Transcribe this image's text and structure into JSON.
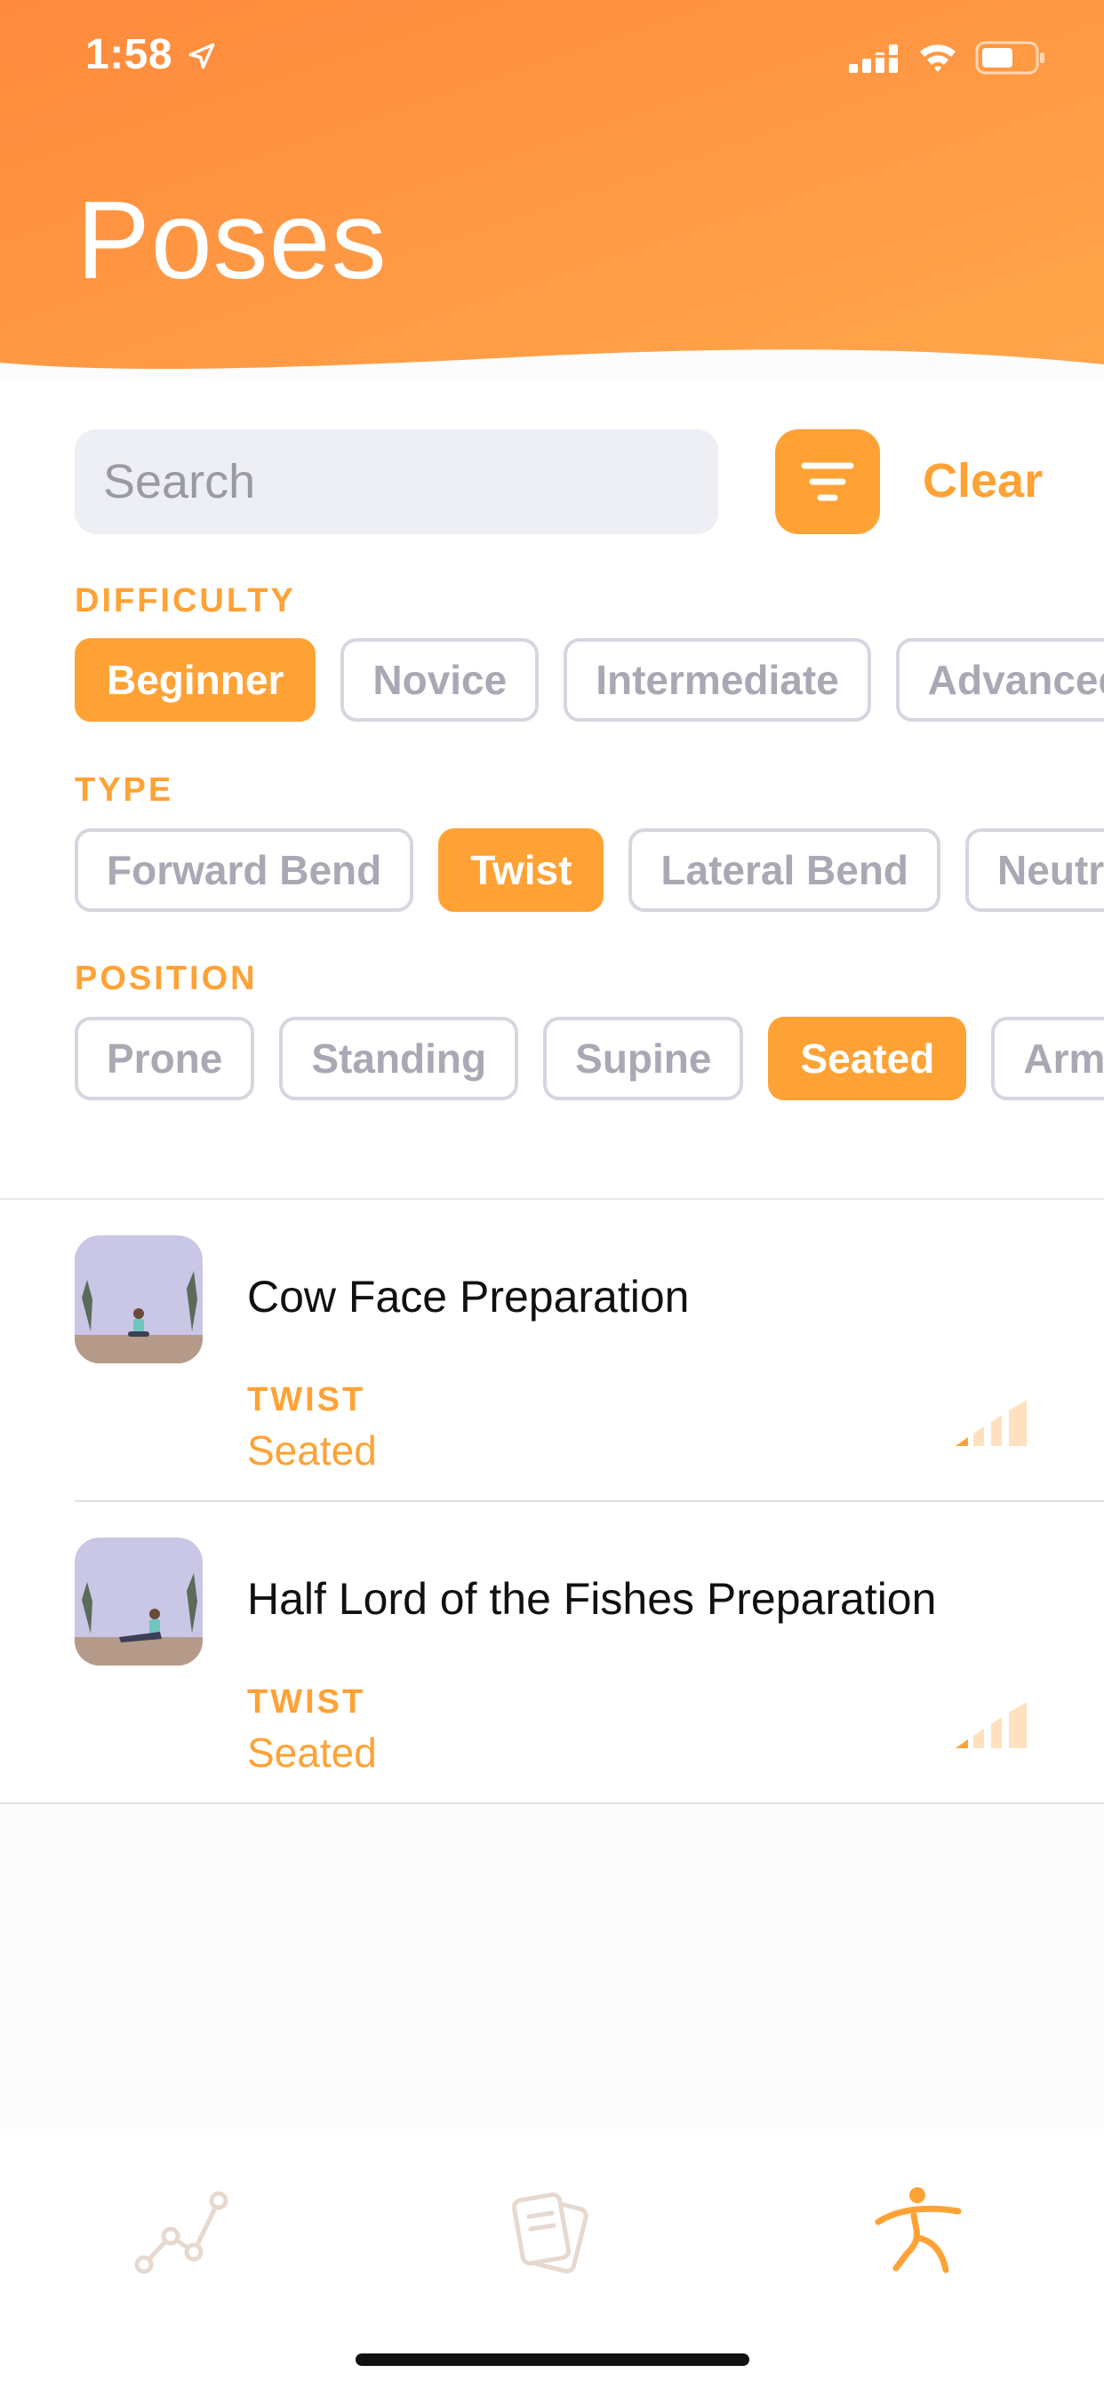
{
  "status_bar": {
    "time": "1:58",
    "icons": [
      "location-arrow-icon",
      "cellular-signal-icon",
      "wifi-icon",
      "battery-icon"
    ]
  },
  "header": {
    "title": "Poses",
    "gradient": [
      "#ff8a3d",
      "#ffa64a"
    ]
  },
  "search": {
    "placeholder": "Search",
    "value": ""
  },
  "filter_button_icon": "filter-lines-icon",
  "clear_label": "Clear",
  "filters": {
    "difficulty": {
      "label": "DIFFICULTY",
      "options": [
        {
          "label": "Beginner",
          "selected": true
        },
        {
          "label": "Novice",
          "selected": false
        },
        {
          "label": "Intermediate",
          "selected": false
        },
        {
          "label": "Advanced",
          "selected": false
        }
      ]
    },
    "type": {
      "label": "TYPE",
      "options": [
        {
          "label": "Forward Bend",
          "selected": false
        },
        {
          "label": "Twist",
          "selected": true
        },
        {
          "label": "Lateral Bend",
          "selected": false
        },
        {
          "label": "Neutral",
          "selected": false
        }
      ]
    },
    "position": {
      "label": "POSITION",
      "options": [
        {
          "label": "Prone",
          "selected": false
        },
        {
          "label": "Standing",
          "selected": false
        },
        {
          "label": "Supine",
          "selected": false
        },
        {
          "label": "Seated",
          "selected": true
        },
        {
          "label": "Arm",
          "selected": false
        }
      ]
    }
  },
  "poses": [
    {
      "name": "Cow Face Preparation",
      "type": "TWIST",
      "position": "Seated",
      "difficulty_level": 1,
      "difficulty_max": 4
    },
    {
      "name": "Half Lord of the Fishes Preparation",
      "type": "TWIST",
      "position": "Seated",
      "difficulty_level": 1,
      "difficulty_max": 4
    }
  ],
  "tab_bar": {
    "tabs": [
      {
        "icon": "progress-chart-icon",
        "active": false
      },
      {
        "icon": "sessions-cards-icon",
        "active": false
      },
      {
        "icon": "poses-figure-icon",
        "active": true
      }
    ]
  },
  "colors": {
    "accent": "#ffa235",
    "chip_border": "#d6d6e0",
    "chip_text": "#a9a9b5",
    "inactive_tab": "#e7d9cf"
  }
}
